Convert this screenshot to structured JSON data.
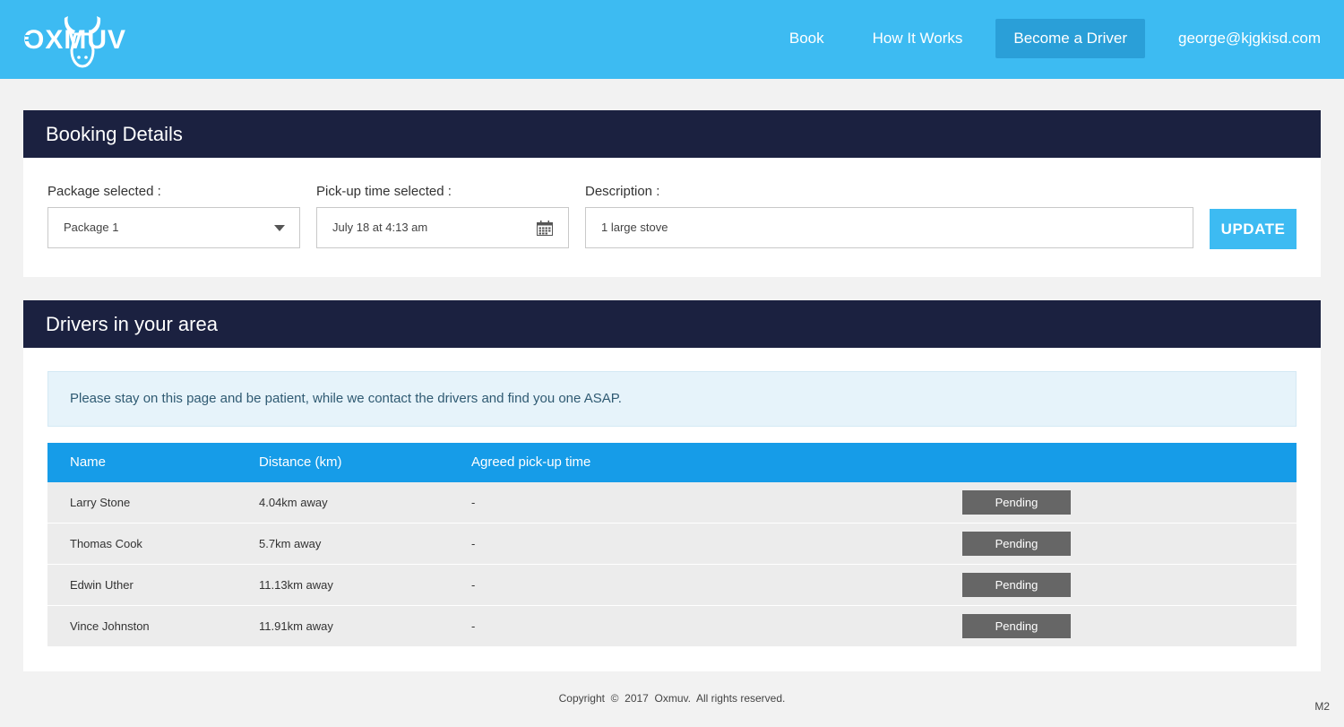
{
  "header": {
    "logo_text": "OXMUV",
    "nav": [
      {
        "label": "Book"
      },
      {
        "label": "How It Works"
      },
      {
        "label": "Become a Driver"
      },
      {
        "label": "george@kjgkisd.com"
      }
    ]
  },
  "booking": {
    "title": "Booking Details",
    "package": {
      "label": "Package selected :",
      "value": "Package 1"
    },
    "pickup": {
      "label": "Pick-up time selected :",
      "value": "July 18 at 4:13 am"
    },
    "description": {
      "label": "Description :",
      "value": "1 large stove"
    },
    "update_label": "UPDATE"
  },
  "drivers": {
    "title": "Drivers in your area",
    "notice": "Please stay on this page and be patient, while we contact the drivers and find you one ASAP.",
    "columns": [
      "Name",
      "Distance (km)",
      "Agreed pick-up time"
    ],
    "rows": [
      {
        "name": "Larry Stone",
        "distance": "4.04km away",
        "time": "-",
        "status": "Pending"
      },
      {
        "name": "Thomas Cook",
        "distance": "5.7km away",
        "time": "-",
        "status": "Pending"
      },
      {
        "name": "Edwin Uther",
        "distance": "11.13km away",
        "time": "-",
        "status": "Pending"
      },
      {
        "name": "Vince Johnston",
        "distance": "11.91km away",
        "time": "-",
        "status": "Pending"
      }
    ]
  },
  "footer": {
    "copyright": "Copyright  ©  2017  Oxmuv.  All rights reserved.",
    "build": "M2"
  },
  "colors": {
    "topbar": "#3dbbf2",
    "panel_header": "#1b2140",
    "table_header": "#169ce8",
    "status_badge": "#666666"
  }
}
